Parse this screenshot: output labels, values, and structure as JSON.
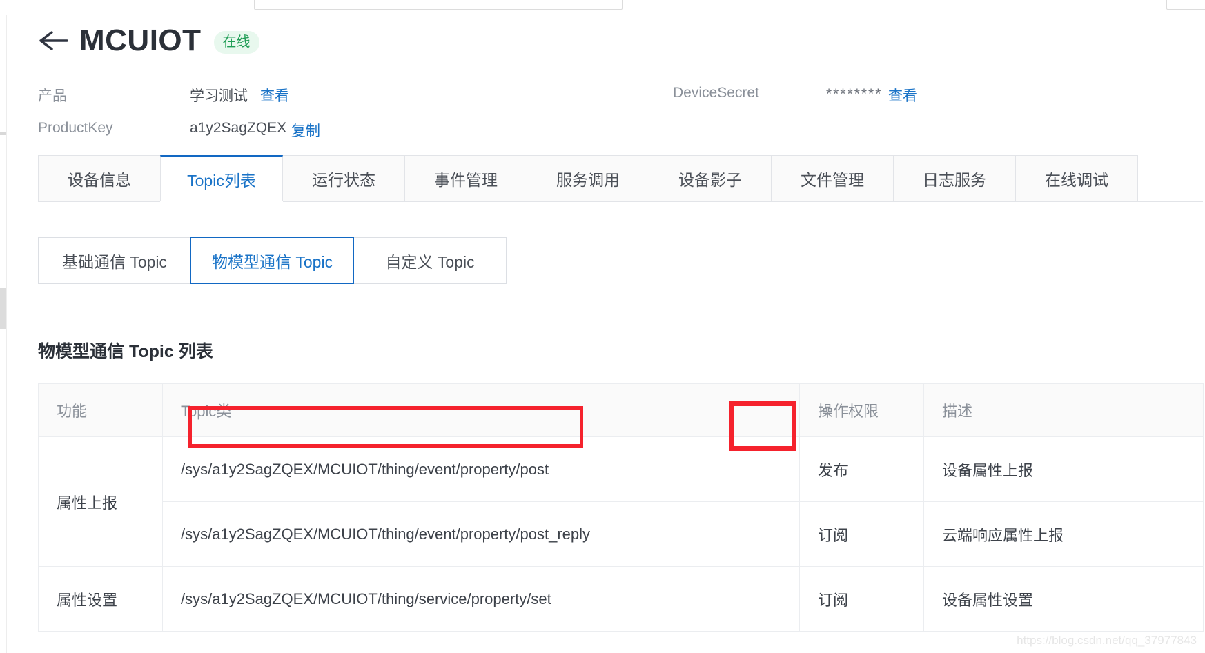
{
  "header": {
    "back_icon": "arrow-left-icon",
    "title": "MCUIOT",
    "status": "在线"
  },
  "meta": {
    "product_label": "产品",
    "product_value": "学习测试",
    "product_link": "查看",
    "device_secret_label": "DeviceSecret",
    "device_secret_value": "********",
    "device_secret_link": "查看",
    "product_key_label": "ProductKey",
    "product_key_value": "a1y2SagZQEX",
    "product_key_link": "复制"
  },
  "tabs": [
    {
      "label": "设备信息",
      "active": false
    },
    {
      "label": "Topic列表",
      "active": true
    },
    {
      "label": "运行状态",
      "active": false
    },
    {
      "label": "事件管理",
      "active": false
    },
    {
      "label": "服务调用",
      "active": false
    },
    {
      "label": "设备影子",
      "active": false
    },
    {
      "label": "文件管理",
      "active": false
    },
    {
      "label": "日志服务",
      "active": false
    },
    {
      "label": "在线调试",
      "active": false
    }
  ],
  "subtabs": [
    {
      "label": "基础通信 Topic",
      "active": false
    },
    {
      "label": "物模型通信 Topic",
      "active": true
    },
    {
      "label": "自定义 Topic",
      "active": false
    }
  ],
  "section": {
    "title": "物模型通信 Topic 列表"
  },
  "table": {
    "columns": [
      "功能",
      "Topic类",
      "操作权限",
      "描述"
    ],
    "rows": [
      {
        "function": "属性上报",
        "function_rowspan": 2,
        "topic": "/sys/a1y2SagZQEX/MCUIOT/thing/event/property/post",
        "permission": "发布",
        "description": "设备属性上报",
        "highlight_topic": true,
        "highlight_permission": true
      },
      {
        "function": "",
        "topic": "/sys/a1y2SagZQEX/MCUIOT/thing/event/property/post_reply",
        "permission": "订阅",
        "description": "云端响应属性上报",
        "highlight_topic": false,
        "highlight_permission": false
      },
      {
        "function": "属性设置",
        "function_rowspan": 1,
        "topic": "/sys/a1y2SagZQEX/MCUIOT/thing/service/property/set",
        "permission": "订阅",
        "description": "设备属性设置",
        "highlight_topic": false,
        "highlight_permission": false
      }
    ]
  },
  "watermark": "https://blog.csdn.net/qq_37977843",
  "colors": {
    "accent": "#1a73c7",
    "accent_border": "#1268c3",
    "status_text": "#1f9d55",
    "status_bg": "#e8f8ee",
    "highlight": "#f5222d",
    "text": "#3d424a",
    "muted": "#8a9099"
  }
}
